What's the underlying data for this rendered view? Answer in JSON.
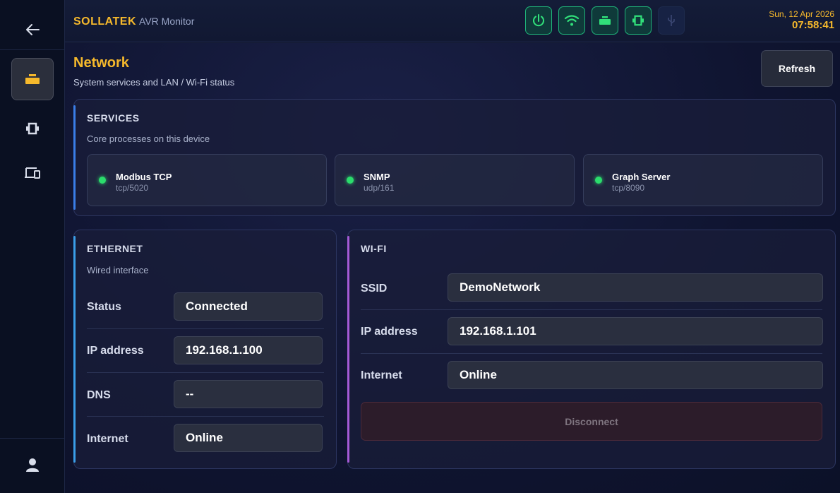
{
  "app": {
    "brand": "SOLLATEK",
    "product": "AVR Monitor",
    "date": "Sun, 12 Apr 2026",
    "time": "07:58:41"
  },
  "status_icons": [
    "power-icon",
    "wifi-icon",
    "battery-icon",
    "motor-icon",
    "usb-icon"
  ],
  "sidebar": {
    "items": [
      "back-arrow-icon",
      "battery-icon",
      "motor-icon",
      "devices-icon",
      "user-icon"
    ]
  },
  "page": {
    "title": "Network",
    "subtitle": "System services and LAN / Wi-Fi status",
    "refresh_label": "Refresh"
  },
  "services": {
    "title": "SERVICES",
    "subtitle": "Core processes on this device",
    "items": [
      {
        "name": "Modbus TCP",
        "port": "tcp/5020"
      },
      {
        "name": "SNMP",
        "port": "udp/161"
      },
      {
        "name": "Graph Server",
        "port": "tcp/8090"
      }
    ]
  },
  "ethernet": {
    "title": "ETHERNET",
    "subtitle": "Wired interface",
    "rows": [
      {
        "label": "Status",
        "value": "Connected"
      },
      {
        "label": "IP address",
        "value": "192.168.1.100"
      },
      {
        "label": "DNS",
        "value": "--"
      },
      {
        "label": "Internet",
        "value": "Online"
      }
    ]
  },
  "wifi": {
    "title": "WI-FI",
    "rows": [
      {
        "label": "SSID",
        "value": "DemoNetwork"
      },
      {
        "label": "IP address",
        "value": "192.168.1.101"
      },
      {
        "label": "Internet",
        "value": "Online"
      }
    ],
    "disconnect_label": "Disconnect"
  },
  "colors": {
    "accent": "#f6b92c",
    "ok": "#2bdc6c",
    "ethernet_accent": "#3a9ee8",
    "wifi_accent": "#a45ad6"
  }
}
